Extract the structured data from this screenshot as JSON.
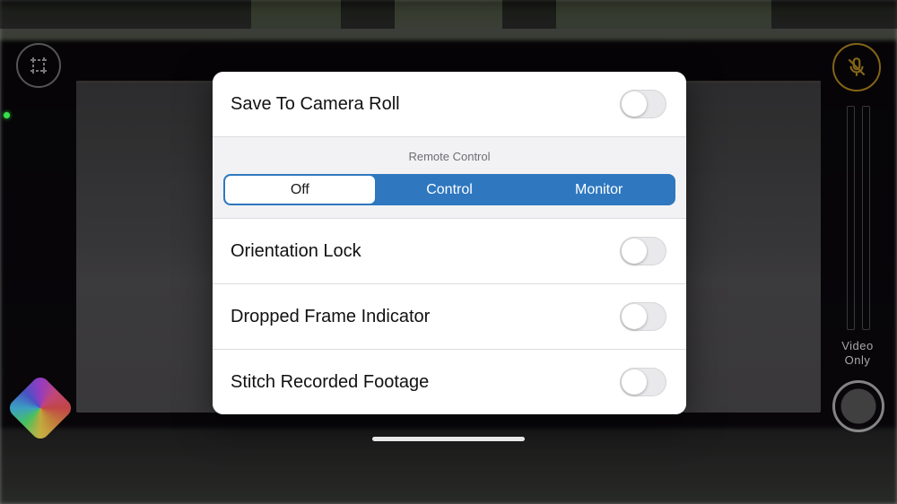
{
  "settings": {
    "save_camera_roll": {
      "label": "Save To Camera Roll",
      "value": false
    },
    "remote_control": {
      "title": "Remote Control",
      "options": [
        "Off",
        "Control",
        "Monitor"
      ],
      "selected": "Off"
    },
    "orientation_lock": {
      "label": "Orientation Lock",
      "value": false
    },
    "dropped_frame": {
      "label": "Dropped Frame Indicator",
      "value": false
    },
    "stitch_footage": {
      "label": "Stitch Recorded Footage",
      "value": false
    }
  },
  "side": {
    "caption_line1": "Video",
    "caption_line2": "Only"
  }
}
